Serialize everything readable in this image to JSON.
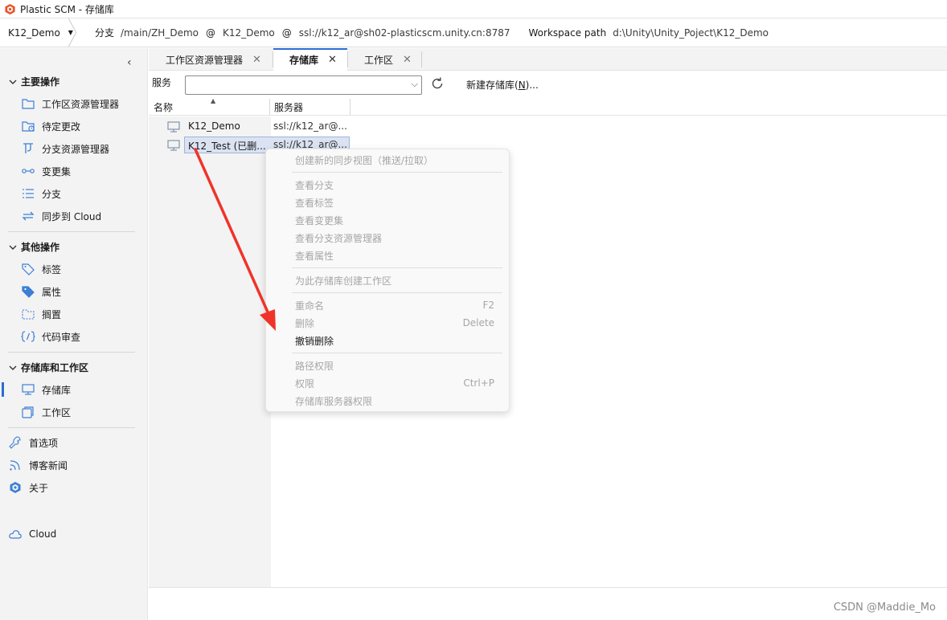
{
  "window": {
    "title": "Plastic SCM - 存储库"
  },
  "toolbar": {
    "workspace": "K12_Demo",
    "branch_label": "分支",
    "branch_path": "/main/ZH_Demo",
    "at1": "@",
    "repo": "K12_Demo",
    "at2": "@",
    "server": "ssl://k12_ar@sh02-plasticscm.unity.cn:8787",
    "workspace_path_label": "Workspace path",
    "workspace_path": "d:\\Unity\\Unity_Poject\\K12_Demo"
  },
  "sidebar": {
    "collapse": "‹",
    "main_ops": {
      "title": "主要操作",
      "items": [
        "工作区资源管理器",
        "待定更改",
        "分支资源管理器",
        "变更集",
        "分支",
        "同步到 Cloud"
      ]
    },
    "other_ops": {
      "title": "其他操作",
      "items": [
        "标签",
        "属性",
        "搁置",
        "代码审查"
      ]
    },
    "repo_ws": {
      "title": "存储库和工作区",
      "items": [
        "存储库",
        "工作区"
      ]
    },
    "bottom": [
      "首选项",
      "博客新闻",
      "关于",
      "Cloud"
    ]
  },
  "tabs": [
    {
      "label": "工作区资源管理器",
      "close": "✕"
    },
    {
      "label": "存储库",
      "close": "✕"
    },
    {
      "label": "工作区",
      "close": "✕"
    }
  ],
  "server_row": {
    "label": "服务",
    "value": "",
    "new_repo": "新建存储库(",
    "new_repo_key": "N",
    "new_repo_tail": ")..."
  },
  "list": {
    "col_name": "名称",
    "col_server": "服务器",
    "rows": [
      {
        "name": "K12_Demo",
        "server": "ssl://k12_ar@..."
      },
      {
        "name": "K12_Test (已删...",
        "server": "ssl://k12_ar@..."
      }
    ]
  },
  "context_menu": {
    "items": [
      {
        "label": "创建新的同步视图（推送/拉取）",
        "shortcut": "",
        "enabled": false
      },
      {
        "label": "查看分支",
        "shortcut": "",
        "enabled": false
      },
      {
        "label": "查看标签",
        "shortcut": "",
        "enabled": false
      },
      {
        "label": "查看变更集",
        "shortcut": "",
        "enabled": false
      },
      {
        "label": "查看分支资源管理器",
        "shortcut": "",
        "enabled": false
      },
      {
        "label": "查看属性",
        "shortcut": "",
        "enabled": false
      },
      {
        "label": "为此存储库创建工作区",
        "shortcut": "",
        "enabled": false
      },
      {
        "label": "重命名",
        "shortcut": "F2",
        "enabled": false
      },
      {
        "label": "删除",
        "shortcut": "Delete",
        "enabled": false
      },
      {
        "label": "撤销删除",
        "shortcut": "",
        "enabled": true
      },
      {
        "label": "路径权限",
        "shortcut": "",
        "enabled": false
      },
      {
        "label": "权限",
        "shortcut": "Ctrl+P",
        "enabled": false
      },
      {
        "label": "存储库服务器权限",
        "shortcut": "",
        "enabled": false
      }
    ]
  },
  "watermark": "CSDN @Maddie_Mo",
  "colors": {
    "accent": "#2b6cd4",
    "annotation_arrow": "#f0332a",
    "logo": "#e8562a"
  }
}
